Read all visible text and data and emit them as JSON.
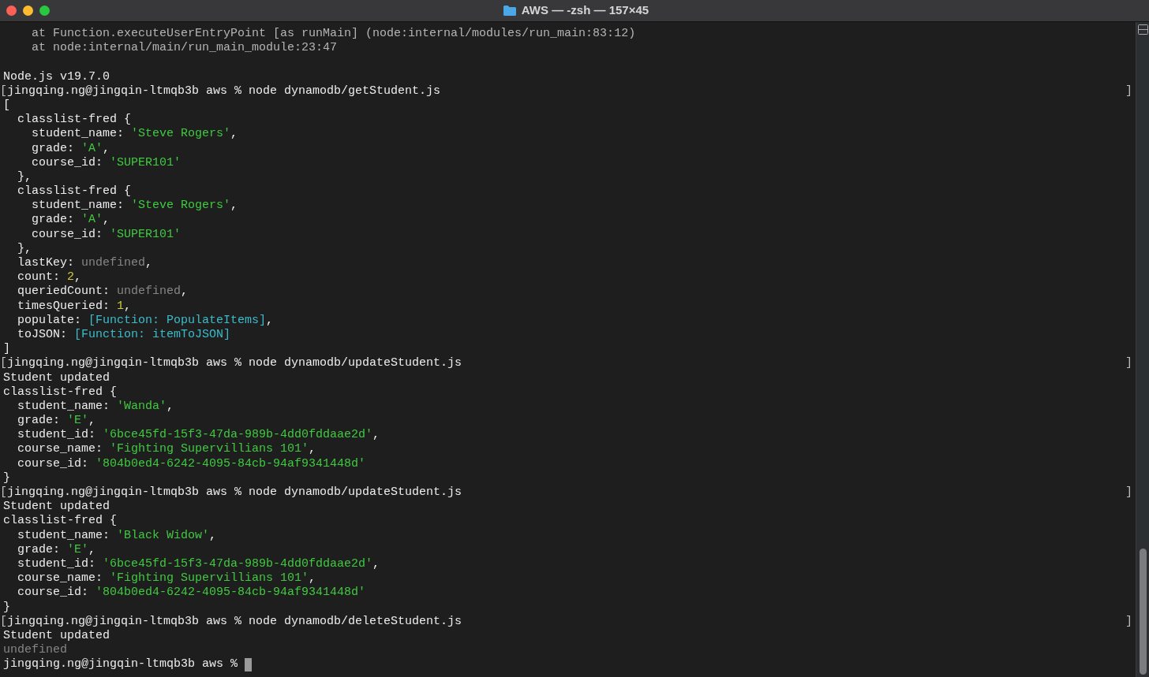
{
  "window": {
    "title": "AWS — -zsh — 157×45"
  },
  "lines": [
    {
      "segments": [
        {
          "text": "    at Function.executeUserEntryPoint [as runMain] (node:internal/modules/run_main:83:12)",
          "kind": "trace"
        }
      ]
    },
    {
      "segments": [
        {
          "text": "    at node:internal/main/run_main_module:23:47",
          "kind": "trace"
        }
      ]
    },
    {
      "blank_line_before": true,
      "segments": [
        {
          "text": "Node.js v19.7.0",
          "kind": "plain"
        }
      ]
    },
    {
      "left_mark": "[",
      "right_mark": "]",
      "segments": [
        {
          "text": "jingqing.ng@jingqin-ltmqb3b aws % node dynamodb/getStudent.js",
          "kind": "plain"
        }
      ]
    },
    {
      "segments": [
        {
          "text": "[",
          "kind": "plain"
        }
      ]
    },
    {
      "segments": [
        {
          "text": "  classlist-fred {",
          "kind": "plain"
        }
      ]
    },
    {
      "segments": [
        {
          "text": "    student_name: ",
          "kind": "plain"
        },
        {
          "text": "'Steve Rogers'",
          "kind": "string"
        },
        {
          "text": ",",
          "kind": "plain"
        }
      ]
    },
    {
      "segments": [
        {
          "text": "    grade: ",
          "kind": "plain"
        },
        {
          "text": "'A'",
          "kind": "string"
        },
        {
          "text": ",",
          "kind": "plain"
        }
      ]
    },
    {
      "segments": [
        {
          "text": "    course_id: ",
          "kind": "plain"
        },
        {
          "text": "'SUPER101'",
          "kind": "string"
        }
      ]
    },
    {
      "segments": [
        {
          "text": "  },",
          "kind": "plain"
        }
      ]
    },
    {
      "segments": [
        {
          "text": "  classlist-fred {",
          "kind": "plain"
        }
      ]
    },
    {
      "segments": [
        {
          "text": "    student_name: ",
          "kind": "plain"
        },
        {
          "text": "'Steve Rogers'",
          "kind": "string"
        },
        {
          "text": ",",
          "kind": "plain"
        }
      ]
    },
    {
      "segments": [
        {
          "text": "    grade: ",
          "kind": "plain"
        },
        {
          "text": "'A'",
          "kind": "string"
        },
        {
          "text": ",",
          "kind": "plain"
        }
      ]
    },
    {
      "segments": [
        {
          "text": "    course_id: ",
          "kind": "plain"
        },
        {
          "text": "'SUPER101'",
          "kind": "string"
        }
      ]
    },
    {
      "segments": [
        {
          "text": "  },",
          "kind": "plain"
        }
      ]
    },
    {
      "segments": [
        {
          "text": "  lastKey: ",
          "kind": "plain"
        },
        {
          "text": "undefined",
          "kind": "dim"
        },
        {
          "text": ",",
          "kind": "plain"
        }
      ]
    },
    {
      "segments": [
        {
          "text": "  count: ",
          "kind": "plain"
        },
        {
          "text": "2",
          "kind": "number"
        },
        {
          "text": ",",
          "kind": "plain"
        }
      ]
    },
    {
      "segments": [
        {
          "text": "  queriedCount: ",
          "kind": "plain"
        },
        {
          "text": "undefined",
          "kind": "dim"
        },
        {
          "text": ",",
          "kind": "plain"
        }
      ]
    },
    {
      "segments": [
        {
          "text": "  timesQueried: ",
          "kind": "plain"
        },
        {
          "text": "1",
          "kind": "number"
        },
        {
          "text": ",",
          "kind": "plain"
        }
      ]
    },
    {
      "segments": [
        {
          "text": "  populate: ",
          "kind": "plain"
        },
        {
          "text": "[Function: PopulateItems]",
          "kind": "special"
        },
        {
          "text": ",",
          "kind": "plain"
        }
      ]
    },
    {
      "segments": [
        {
          "text": "  toJSON: ",
          "kind": "plain"
        },
        {
          "text": "[Function: itemToJSON]",
          "kind": "special"
        }
      ]
    },
    {
      "segments": [
        {
          "text": "]",
          "kind": "plain"
        }
      ]
    },
    {
      "left_mark": "[",
      "right_mark": "]",
      "segments": [
        {
          "text": "jingqing.ng@jingqin-ltmqb3b aws % node dynamodb/updateStudent.js",
          "kind": "plain"
        }
      ]
    },
    {
      "segments": [
        {
          "text": "Student updated",
          "kind": "plain"
        }
      ]
    },
    {
      "segments": [
        {
          "text": "classlist-fred {",
          "kind": "plain"
        }
      ]
    },
    {
      "segments": [
        {
          "text": "  student_name: ",
          "kind": "plain"
        },
        {
          "text": "'Wanda'",
          "kind": "string"
        },
        {
          "text": ",",
          "kind": "plain"
        }
      ]
    },
    {
      "segments": [
        {
          "text": "  grade: ",
          "kind": "plain"
        },
        {
          "text": "'E'",
          "kind": "string"
        },
        {
          "text": ",",
          "kind": "plain"
        }
      ]
    },
    {
      "segments": [
        {
          "text": "  student_id: ",
          "kind": "plain"
        },
        {
          "text": "'6bce45fd-15f3-47da-989b-4dd0fddaae2d'",
          "kind": "string"
        },
        {
          "text": ",",
          "kind": "plain"
        }
      ]
    },
    {
      "segments": [
        {
          "text": "  course_name: ",
          "kind": "plain"
        },
        {
          "text": "'Fighting Supervillians 101'",
          "kind": "string"
        },
        {
          "text": ",",
          "kind": "plain"
        }
      ]
    },
    {
      "segments": [
        {
          "text": "  course_id: ",
          "kind": "plain"
        },
        {
          "text": "'804b0ed4-6242-4095-84cb-94af9341448d'",
          "kind": "string"
        }
      ]
    },
    {
      "segments": [
        {
          "text": "}",
          "kind": "plain"
        }
      ]
    },
    {
      "left_mark": "[",
      "right_mark": "]",
      "segments": [
        {
          "text": "jingqing.ng@jingqin-ltmqb3b aws % node dynamodb/updateStudent.js",
          "kind": "plain"
        }
      ]
    },
    {
      "segments": [
        {
          "text": "Student updated",
          "kind": "plain"
        }
      ]
    },
    {
      "segments": [
        {
          "text": "classlist-fred {",
          "kind": "plain"
        }
      ]
    },
    {
      "segments": [
        {
          "text": "  student_name: ",
          "kind": "plain"
        },
        {
          "text": "'Black Widow'",
          "kind": "string"
        },
        {
          "text": ",",
          "kind": "plain"
        }
      ]
    },
    {
      "segments": [
        {
          "text": "  grade: ",
          "kind": "plain"
        },
        {
          "text": "'E'",
          "kind": "string"
        },
        {
          "text": ",",
          "kind": "plain"
        }
      ]
    },
    {
      "segments": [
        {
          "text": "  student_id: ",
          "kind": "plain"
        },
        {
          "text": "'6bce45fd-15f3-47da-989b-4dd0fddaae2d'",
          "kind": "string"
        },
        {
          "text": ",",
          "kind": "plain"
        }
      ]
    },
    {
      "segments": [
        {
          "text": "  course_name: ",
          "kind": "plain"
        },
        {
          "text": "'Fighting Supervillians 101'",
          "kind": "string"
        },
        {
          "text": ",",
          "kind": "plain"
        }
      ]
    },
    {
      "segments": [
        {
          "text": "  course_id: ",
          "kind": "plain"
        },
        {
          "text": "'804b0ed4-6242-4095-84cb-94af9341448d'",
          "kind": "string"
        }
      ]
    },
    {
      "segments": [
        {
          "text": "}",
          "kind": "plain"
        }
      ]
    },
    {
      "left_mark": "[",
      "right_mark": "]",
      "segments": [
        {
          "text": "jingqing.ng@jingqin-ltmqb3b aws % node dynamodb/deleteStudent.js",
          "kind": "plain"
        }
      ]
    },
    {
      "segments": [
        {
          "text": "Student updated",
          "kind": "plain"
        }
      ]
    },
    {
      "segments": [
        {
          "text": "undefined",
          "kind": "dim"
        }
      ]
    },
    {
      "segments": [
        {
          "text": "jingqing.ng@jingqin-ltmqb3b aws % ",
          "kind": "plain"
        }
      ],
      "cursor": true
    }
  ]
}
